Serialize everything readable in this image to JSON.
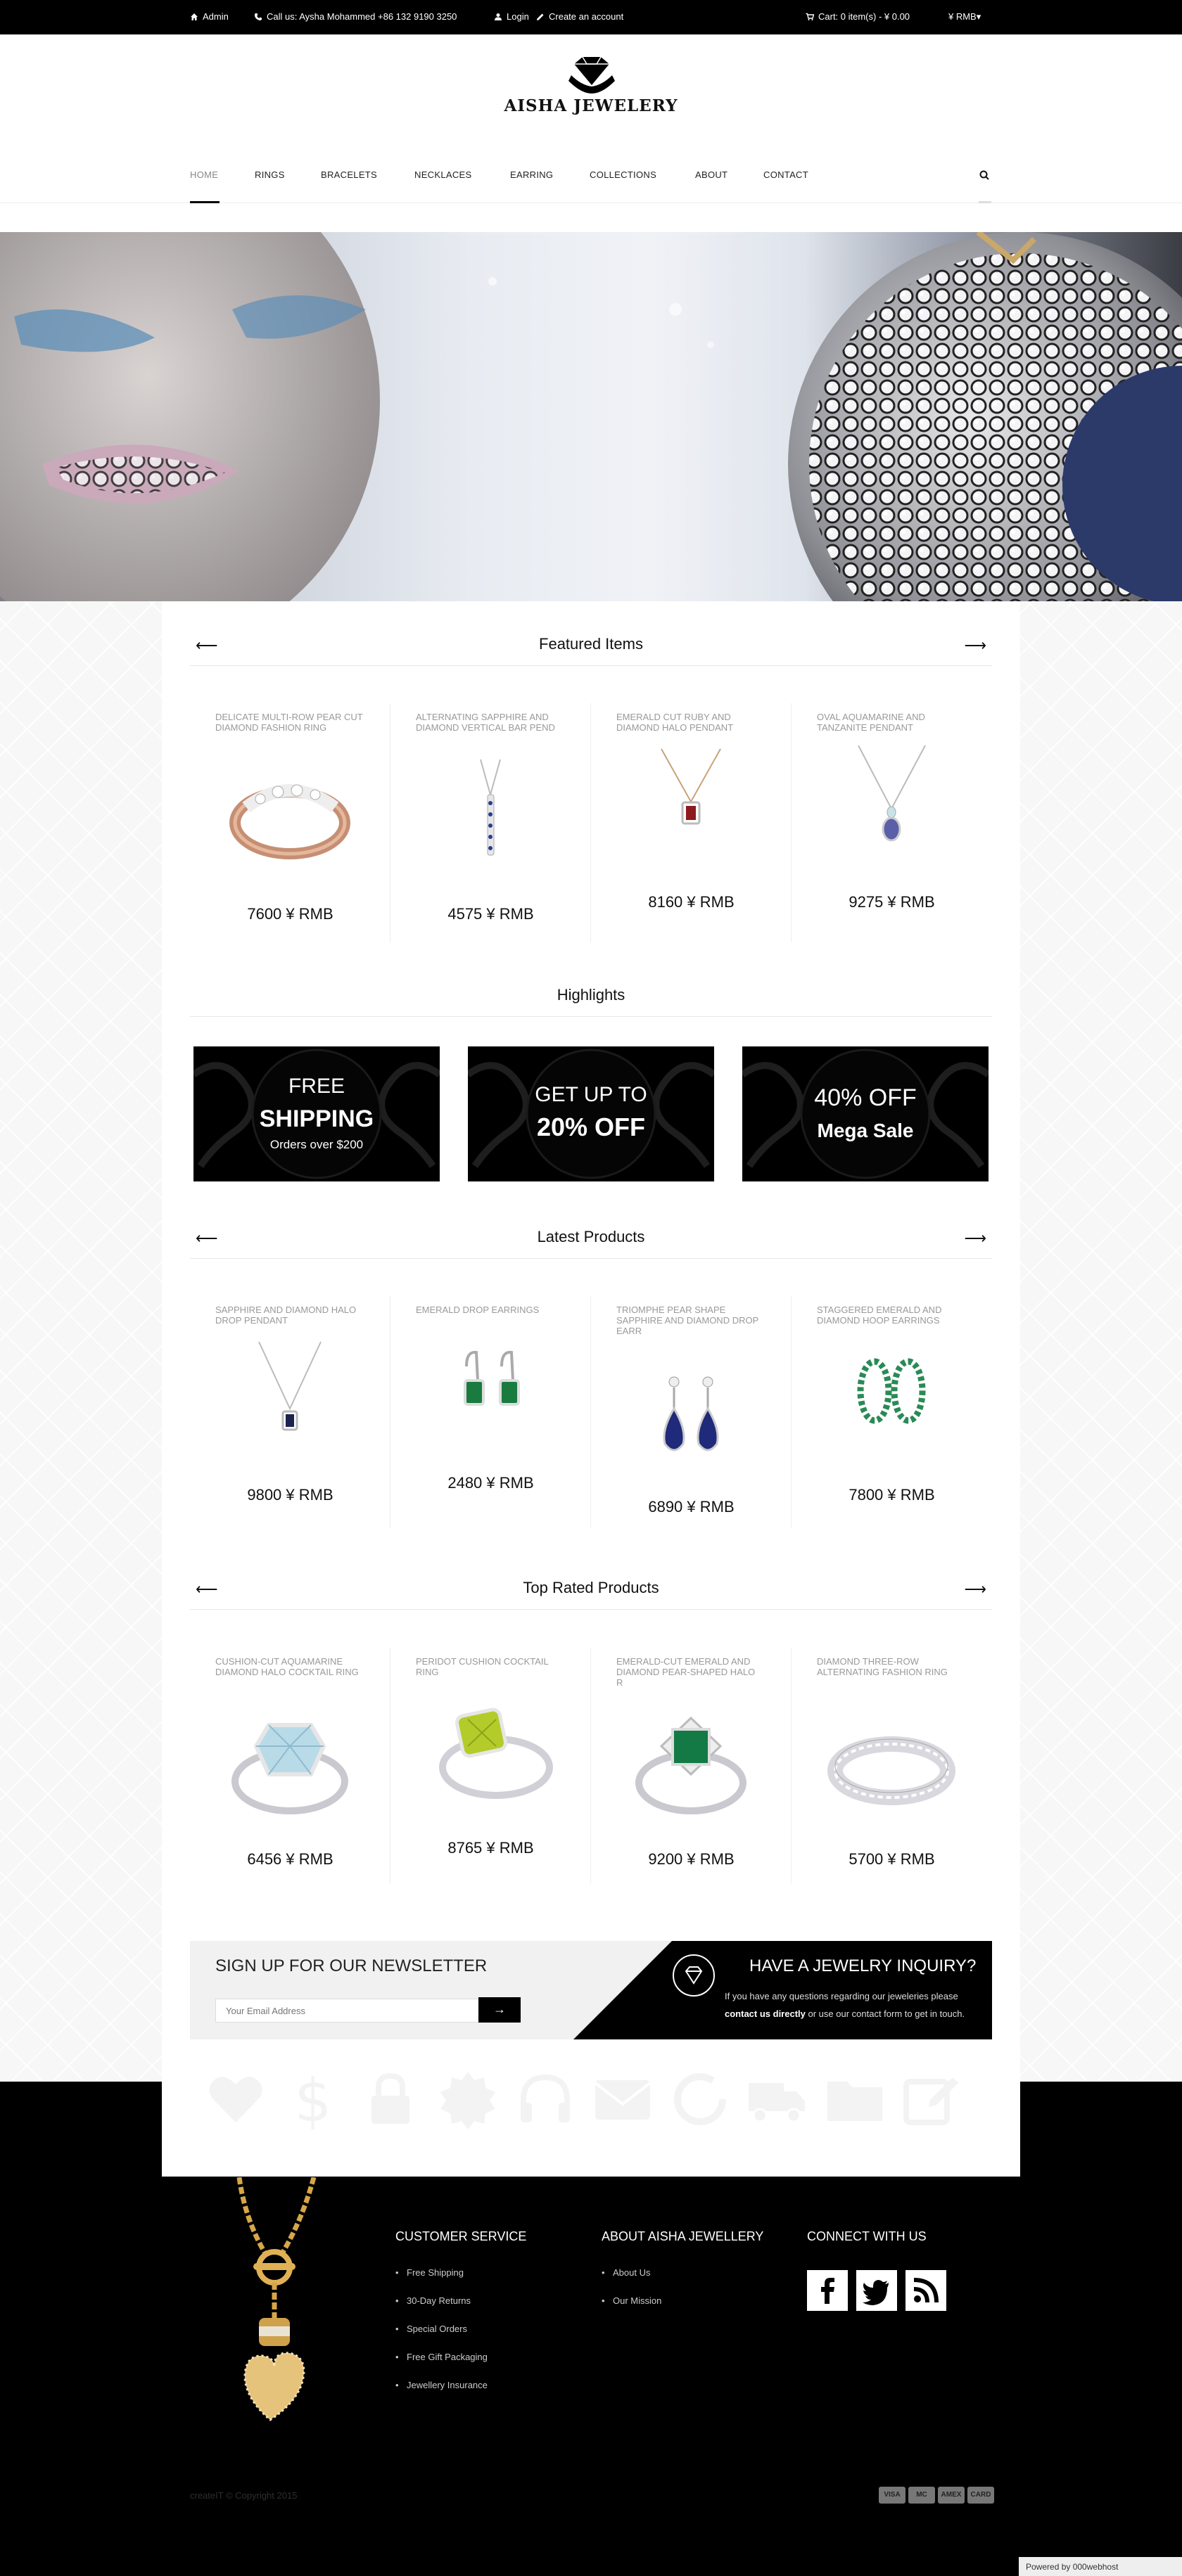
{
  "topbar": {
    "admin": "Admin",
    "call": "Call us: Aysha Mohammed +86 132 9190 3250",
    "login": "Login",
    "create_account": "Create an account",
    "cart": "Cart: 0 item(s) - ¥ 0.00",
    "currency": "¥ RMB▾"
  },
  "header": {
    "brand": "AISHA JEWELERY",
    "nav": [
      "HOME",
      "RINGS",
      "BRACELETS",
      "NECKLACES",
      "EARRING",
      "COLLECTIONS",
      "ABOUT",
      "CONTACT"
    ]
  },
  "featured": {
    "title": "Featured Items",
    "items": [
      {
        "name": "DELICATE MULTI-ROW PEAR CUT DIAMOND FASHION RING",
        "price": "7600 ¥ RMB",
        "icon": "rose-gold-ring"
      },
      {
        "name": "ALTERNATING SAPPHIRE AND DIAMOND VERTICAL BAR PEND",
        "price": "4575 ¥ RMB",
        "icon": "bar-pendant"
      },
      {
        "name": "EMERALD CUT RUBY AND DIAMOND HALO PENDANT",
        "price": "8160 ¥ RMB",
        "icon": "ruby-pendant"
      },
      {
        "name": "OVAL AQUAMARINE AND TANZANITE PENDANT",
        "price": "9275 ¥ RMB",
        "icon": "tanzanite-pendant"
      }
    ]
  },
  "highlights": {
    "title": "Highlights",
    "banners": [
      {
        "line1": "FREE",
        "line2": "SHIPPING",
        "line3": "Orders over $200"
      },
      {
        "line1": "GET UP TO",
        "line2": "20% OFF",
        "line3": ""
      },
      {
        "line1": "40% OFF",
        "line2": "Mega Sale",
        "line3": ""
      }
    ]
  },
  "latest": {
    "title": "Latest Products",
    "items": [
      {
        "name": "SAPPHIRE AND DIAMOND HALO DROP PENDANT",
        "price": "9800 ¥ RMB",
        "icon": "sapphire-pendant"
      },
      {
        "name": "EMERALD DROP EARRINGS",
        "price": "2480 ¥ RMB",
        "icon": "emerald-earrings"
      },
      {
        "name": "TRIOMPHE PEAR SHAPE SAPPHIRE AND DIAMOND DROP EARR",
        "price": "6890 ¥ RMB",
        "icon": "sapphire-drop-earrings"
      },
      {
        "name": "STAGGERED EMERALD AND DIAMOND HOOP EARRINGS",
        "price": "7800 ¥ RMB",
        "icon": "emerald-hoop-earrings"
      }
    ]
  },
  "top_rated": {
    "title": "Top Rated Products",
    "items": [
      {
        "name": "CUSHION-CUT AQUAMARINE DIAMOND HALO COCKTAIL RING",
        "price": "6456 ¥ RMB",
        "icon": "aquamarine-ring"
      },
      {
        "name": "PERIDOT CUSHION COCKTAIL RING",
        "price": "8765 ¥ RMB",
        "icon": "peridot-ring"
      },
      {
        "name": "EMERALD-CUT EMERALD AND DIAMOND PEAR-SHAPED HALO R",
        "price": "9200 ¥ RMB",
        "icon": "emerald-ring"
      },
      {
        "name": "DIAMOND THREE-ROW ALTERNATING FASHION RING",
        "price": "5700 ¥ RMB",
        "icon": "three-row-ring"
      }
    ]
  },
  "newsletter": {
    "title": "SIGN UP FOR OUR NEWSLETTER",
    "placeholder": "Your Email Address",
    "button": "→"
  },
  "inquiry": {
    "title": "HAVE A JEWELRY INQUIRY?",
    "text_before": "If you have any questions regarding our jeweleries please",
    "link": "contact us directly",
    "text_after": "or use our contact form to get in touch."
  },
  "feature_icons": [
    "heart-icon",
    "dollar-icon",
    "lock-icon",
    "badge-icon",
    "headphones-icon",
    "envelope-icon",
    "refresh-icon",
    "truck-icon",
    "folder-icon",
    "edit-icon"
  ],
  "footer": {
    "customer_service": {
      "title": "CUSTOMER SERVICE",
      "links": [
        "Free Shipping",
        "30-Day Returns",
        "Special Orders",
        "Free Gift Packaging",
        "Jewellery Insurance"
      ]
    },
    "about": {
      "title": "ABOUT AISHA JEWELLERY",
      "links": [
        "About Us",
        "Our Mission"
      ]
    },
    "connect": {
      "title": "CONNECT WITH US",
      "social": [
        "facebook-icon",
        "twitter-icon",
        "rss-icon"
      ]
    },
    "copyright": "createIT © Copyright 2015",
    "payment_cards": [
      "VISA",
      "MC",
      "AMEX",
      "CARD"
    ],
    "powered": "Powered by 000webhost"
  }
}
